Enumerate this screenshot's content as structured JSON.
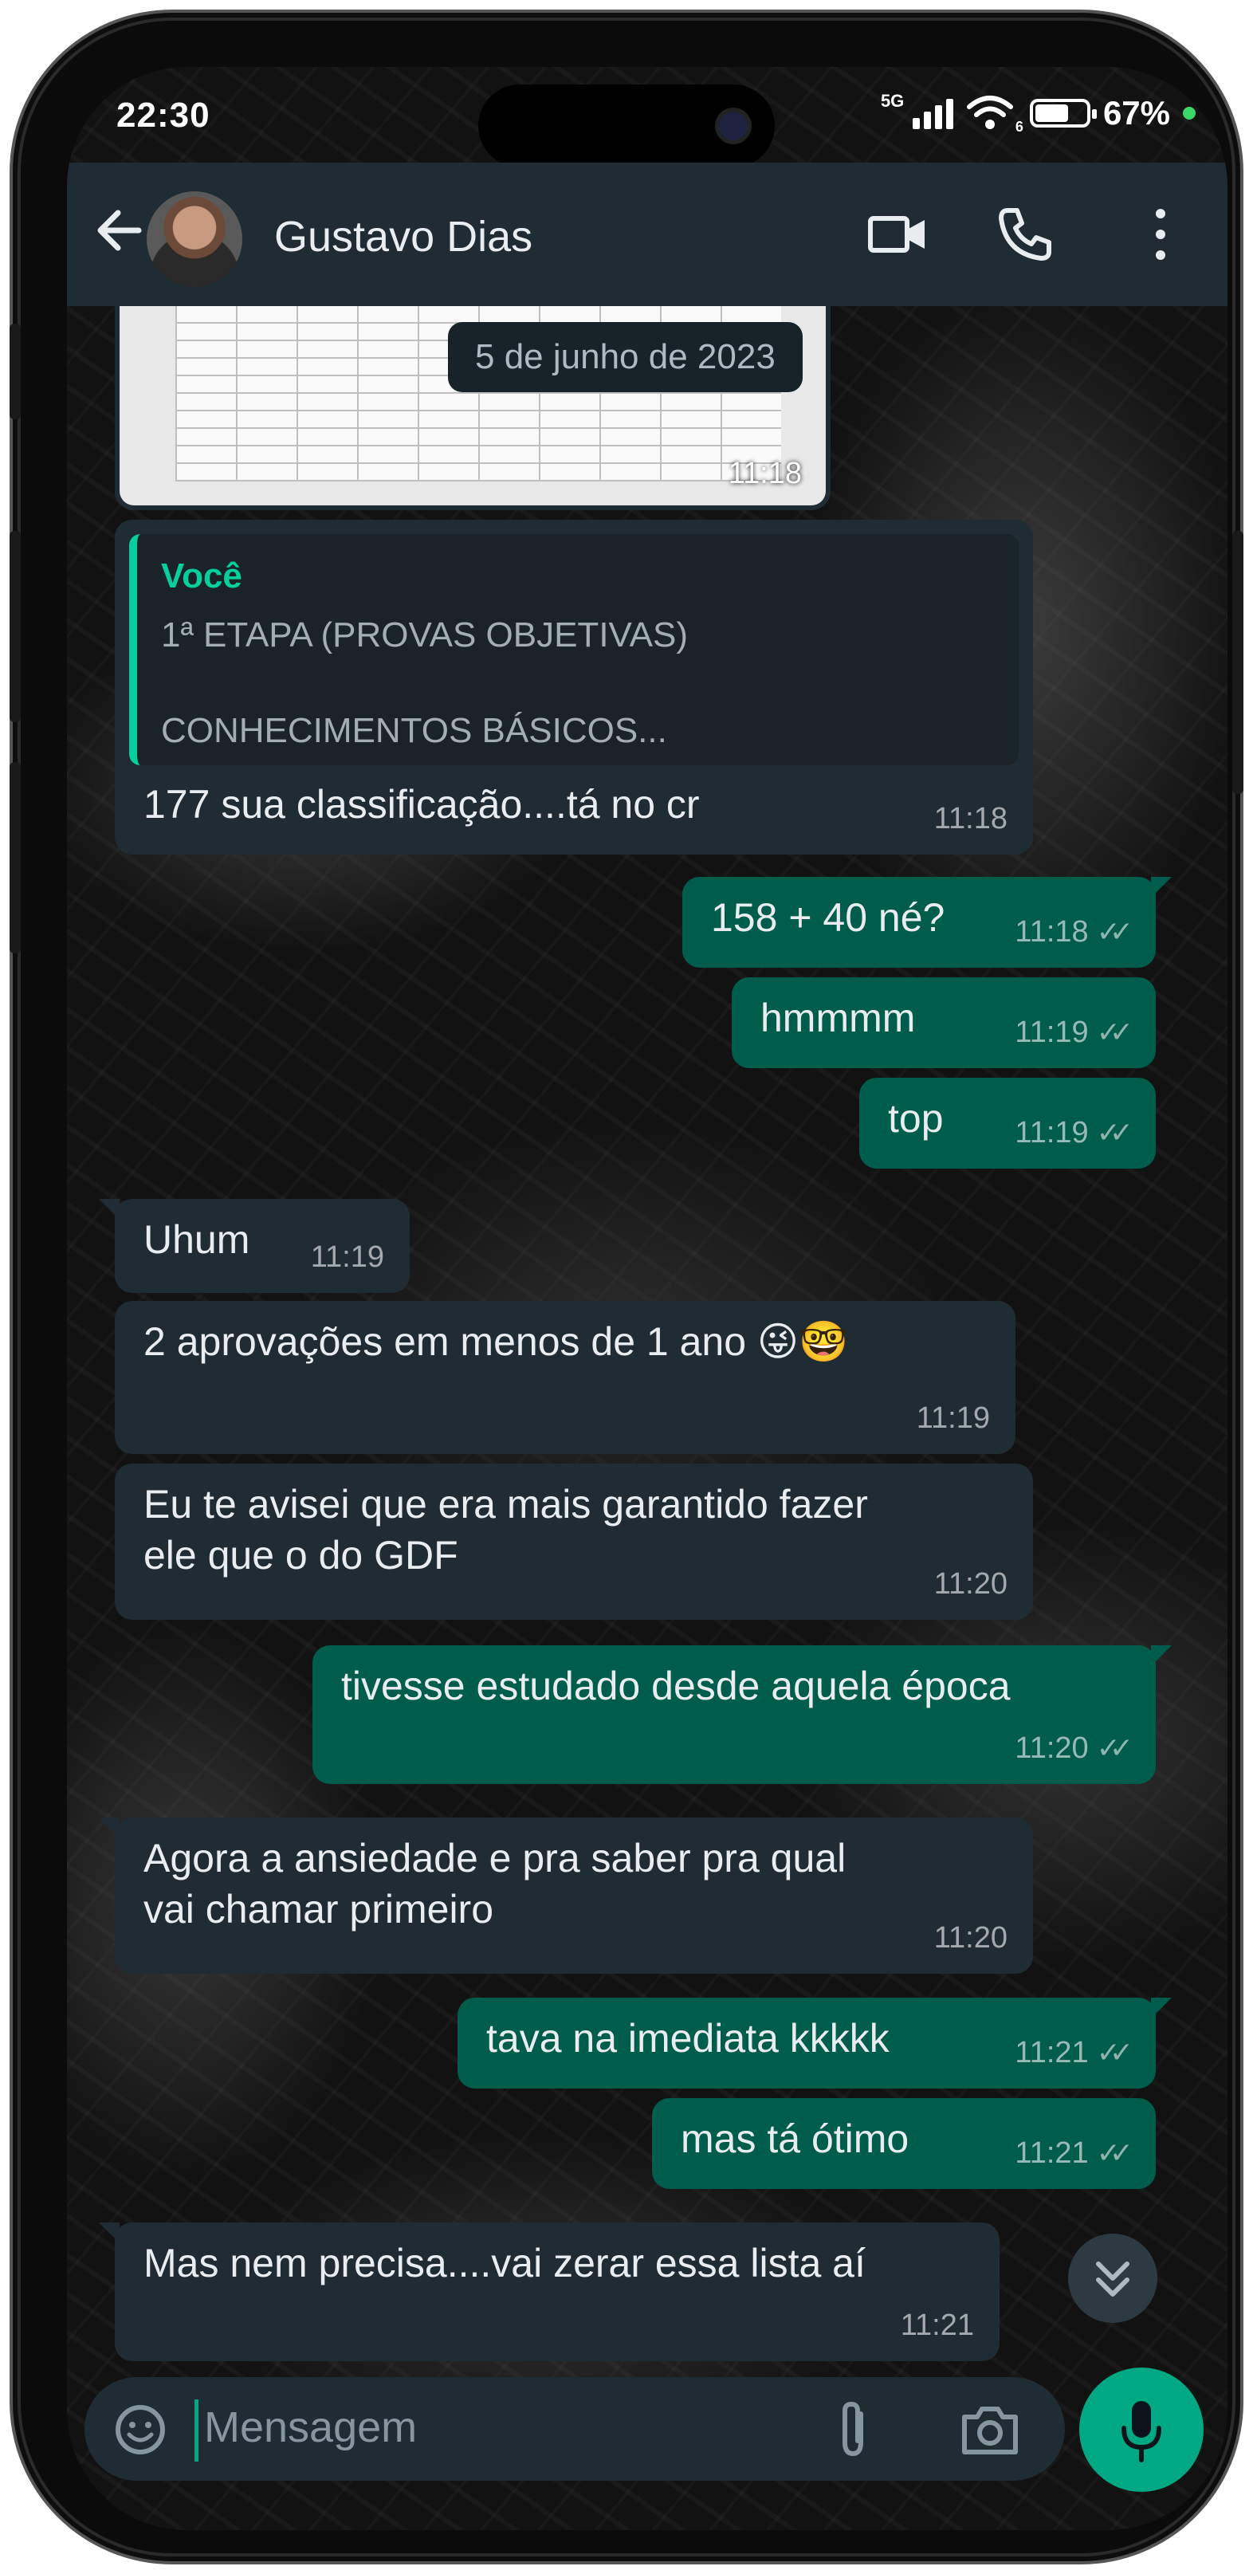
{
  "status_bar": {
    "time": "22:30",
    "network": "5G",
    "wifi_badge": "6",
    "battery": "67%",
    "battery_level": 0.67
  },
  "header": {
    "contact_name": "Gustavo Dias",
    "icons": [
      "back-arrow-icon",
      "video-call-icon",
      "voice-call-icon",
      "more-options-icon"
    ]
  },
  "chat": {
    "date_chip": "5 de junho de 2023",
    "image_message_time": "11:18",
    "quoted_message": {
      "author": "Você",
      "line1": "1ª ETAPA (PROVAS OBJETIVAS)",
      "line2": "CONHECIMENTOS BÁSICOS...",
      "reply_text": "177 sua classificação....tá no cr",
      "time": "11:18"
    },
    "messages": [
      {
        "dir": "out",
        "text": "158 + 40 né?",
        "time": "11:18"
      },
      {
        "dir": "out",
        "text": "hmmmm",
        "time": "11:19"
      },
      {
        "dir": "out",
        "text": "top",
        "time": "11:19"
      },
      {
        "dir": "in",
        "text": "Uhum",
        "time": "11:19"
      },
      {
        "dir": "in",
        "text": "2 aprovações em menos de 1 ano 😜🤓",
        "time": "11:19"
      },
      {
        "dir": "in",
        "text": "Eu te avisei que era mais garantido fazer",
        "text2": "ele que o do GDF",
        "time": "11:20"
      },
      {
        "dir": "out",
        "text": "tivesse estudado desde aquela época",
        "time": "11:20"
      },
      {
        "dir": "in",
        "text": "Agora a ansiedade e pra saber pra qual",
        "text2": "vai chamar primeiro",
        "time": "11:20"
      },
      {
        "dir": "out",
        "text": "tava na imediata kkkkk",
        "time": "11:21"
      },
      {
        "dir": "out",
        "text": "mas tá ótimo",
        "time": "11:21"
      },
      {
        "dir": "in",
        "text": "Mas nem precisa....vai zerar essa lista aí",
        "time": "11:21"
      }
    ],
    "read_ticks": "✓✓"
  },
  "composer": {
    "placeholder": "Mensagem",
    "icons": [
      "emoji-icon",
      "attach-icon",
      "camera-icon",
      "mic-icon"
    ]
  },
  "colors": {
    "header_bg": "#1f2c33",
    "incoming_bubble": "#202c33",
    "outgoing_bubble": "#005c4b",
    "accent": "#00a884"
  }
}
